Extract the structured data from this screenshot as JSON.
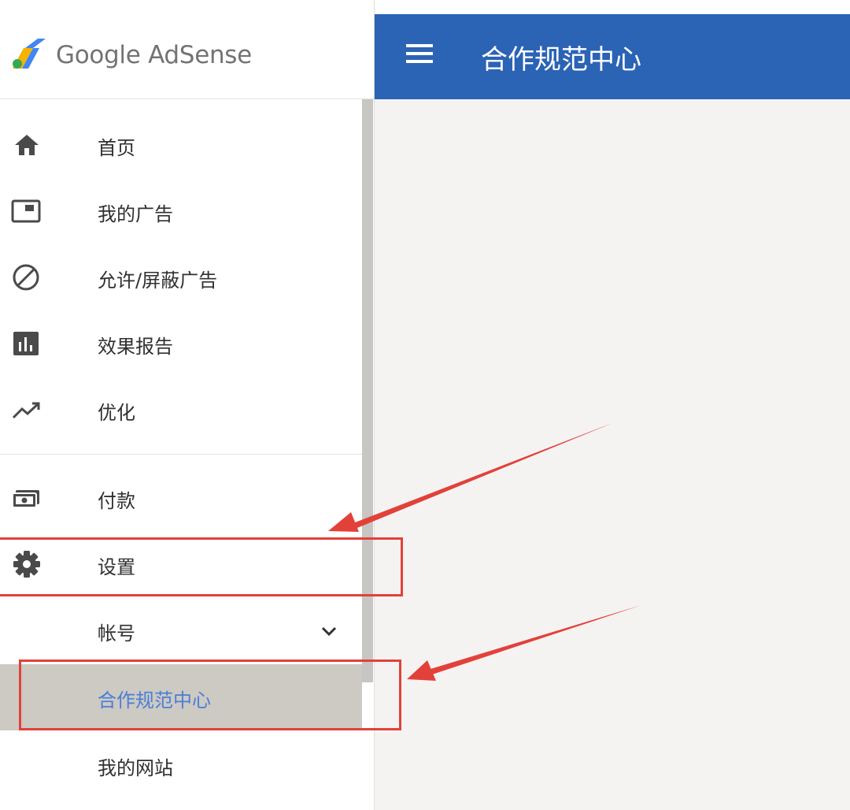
{
  "app": {
    "brand": "Google AdSense"
  },
  "header": {
    "title": "合作规范中心"
  },
  "sidebar": {
    "items": [
      {
        "label": "首页",
        "icon": "home-icon"
      },
      {
        "label": "我的广告",
        "icon": "ad-unit-icon"
      },
      {
        "label": "允许/屏蔽广告",
        "icon": "block-icon"
      },
      {
        "label": "效果报告",
        "icon": "bar-chart-icon"
      },
      {
        "label": "优化",
        "icon": "trending-up-icon"
      },
      {
        "label": "付款",
        "icon": "payment-icon"
      },
      {
        "label": "设置",
        "icon": "gear-icon"
      }
    ],
    "sub_items": [
      {
        "label": "帐号",
        "icon": "chevron-down-icon"
      },
      {
        "label": "合作规范中心",
        "active": true
      },
      {
        "label": "我的网站"
      }
    ]
  },
  "colors": {
    "header_bg": "#2b63b5",
    "active_bg": "#cdc9c3",
    "active_text": "#4a7fd6",
    "annotation": "#e2413a",
    "content_bg": "#f5f3f2"
  }
}
